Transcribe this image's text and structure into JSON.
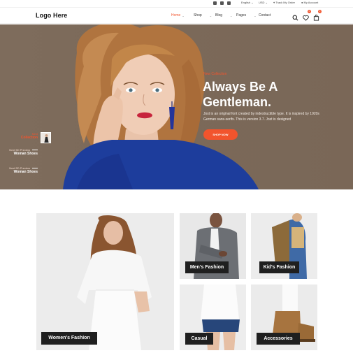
{
  "topbar": {
    "language": "English",
    "currency": "USD",
    "track_order": "Track My Order",
    "account": "My Account",
    "social_icons": [
      "facebook-icon",
      "instagram-icon",
      "twitter-icon"
    ]
  },
  "header": {
    "logo": "Logo Here",
    "nav": [
      {
        "label": "Home",
        "active": true,
        "dropdown": true
      },
      {
        "label": "Shop",
        "active": false,
        "dropdown": true
      },
      {
        "label": "Blog",
        "active": false,
        "dropdown": true
      },
      {
        "label": "Pages",
        "active": false,
        "dropdown": true
      },
      {
        "label": "Contact",
        "active": false,
        "dropdown": false
      }
    ],
    "wishlist_count": "0",
    "cart_count": "0",
    "icons": [
      "search-icon",
      "heart-icon",
      "cart-icon"
    ]
  },
  "hero": {
    "tag": "New Collection",
    "title": "Always Be A Gentleman.",
    "description": "Jost is an original font created by indestructible type. It is inspired by 1920s German sans-serifs. This is version 3.7. Jost is designed",
    "button": "SHOP NOW",
    "side_list": [
      {
        "top": "Next",
        "bottom": "Collection"
      },
      {
        "top": "Next 5D Preview",
        "bottom": "Woman Shoes"
      },
      {
        "top": "Next 5D Preview",
        "bottom": "Woman Shoes"
      }
    ]
  },
  "categories": [
    {
      "label": "Women's Fashion"
    },
    {
      "label": "Men's Fashion"
    },
    {
      "label": "Kid's Fashion"
    },
    {
      "label": "Casual"
    },
    {
      "label": "Accessories"
    }
  ],
  "colors": {
    "accent": "#f2542d",
    "hero_bg": "#7c6a5a",
    "label_bg": "#1f1f1f"
  }
}
